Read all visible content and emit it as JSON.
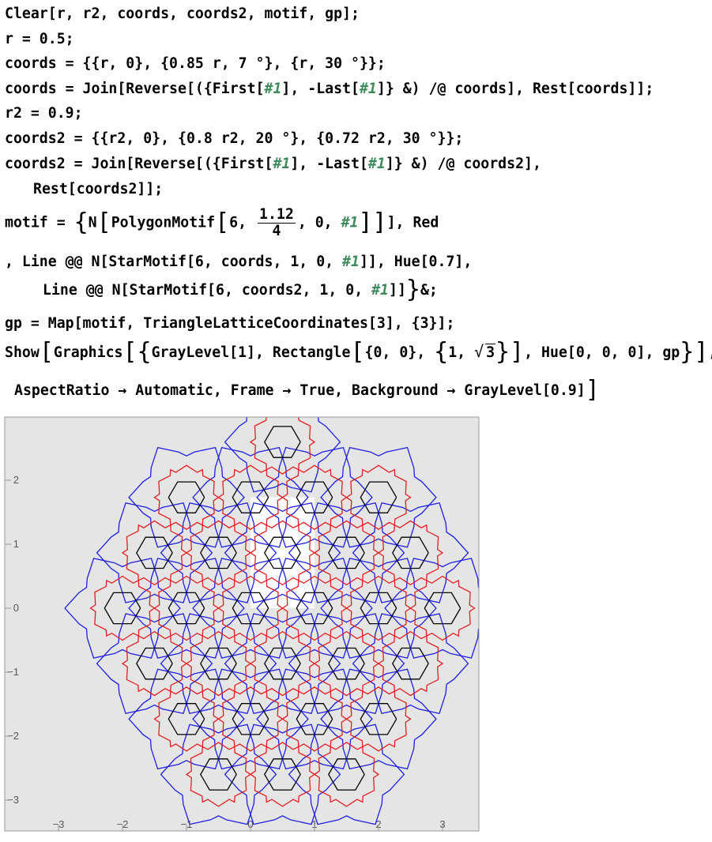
{
  "input_cell": {
    "lines": [
      "Clear[r, r2, coords, coords2, motif, gp];",
      "r = 0.5;",
      "coords = {{r, 0}, {0.85 r, 7 °}, {r, 30 °}};",
      "coords = Join[Reverse[({First[",
      "#1",
      "], -Last[",
      "#1",
      "]} &) /@ coords], Rest[coords]];",
      "r2 = 0.9;",
      "coords2 = {{r2, 0}, {0.8 r2, 20 °}, {0.72 r2, 30 °}};",
      "coords2 = Join[Reverse[({First[",
      "]} &) /@ coords2],",
      "Rest[coords2]];",
      "motif = ",
      "N",
      "PolygonMotif",
      "6, ",
      "1.12",
      "4",
      ", 0, ",
      "], Red",
      ", Line @@ N[StarMotif[6, coords, 1, 0, ",
      "]], Hue[0.7],",
      "Line @@ N[StarMotif[6, coords2, 1, 0, ",
      "]]",
      "&;",
      "gp = Map[motif, TriangleLatticeCoordinates[3], {3}];",
      "Show",
      "Graphics",
      "GrayLevel[1], Rectangle",
      "{0, 0}, ",
      "1, ",
      "3",
      ", Hue[0, 0, 0], gp",
      ",",
      "AspectRatio → Automatic, Frame → True, Background → GrayLevel[0.9]"
    ]
  },
  "output_plot": {
    "background": "#e5e5e5",
    "frame_color": "#999999",
    "x_ticks": [
      "−3",
      "−2",
      "−1",
      "0",
      "1",
      "2",
      "3"
    ],
    "y_ticks": [
      "2",
      "1",
      "0",
      "−1",
      "−2",
      "−3"
    ],
    "colors": {
      "star_outer": "#1f1fe0",
      "star_inner": "#e01f1f",
      "hexagon": "#000000",
      "tile_fill": "#ffffff"
    }
  }
}
